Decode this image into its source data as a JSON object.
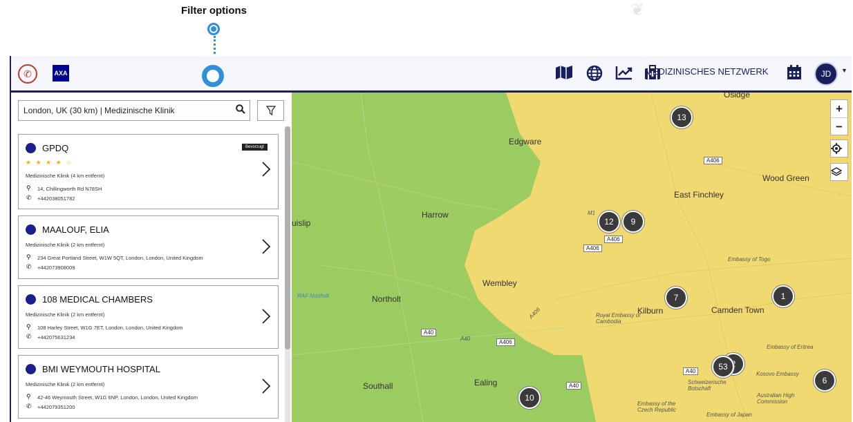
{
  "annotation": {
    "label": "Filter options"
  },
  "header": {
    "logo_text": "AXA",
    "network_label": "MEDIZINISCHES NETZWERK",
    "avatar_initials": "JD",
    "icons": [
      "phone-icon",
      "map-icon",
      "globe-icon",
      "chart-icon",
      "medical-kit-icon",
      "calendar-icon"
    ]
  },
  "search": {
    "value": "London, UK (30 km) | Medizinische Klinik"
  },
  "cards": [
    {
      "name": "GPDQ",
      "badge": "Bevorzugt",
      "stars": "★ ★ ★ ★ ☆",
      "type": "Medizinische Klinik (4 km entfernt)",
      "address": "14, Chillingworth Rd N78SH",
      "phone": "+442038051782"
    },
    {
      "name": "MAALOUF, ELIA",
      "type": "Medizinische Klinik (2 km entfernt)",
      "address": "234 Great Portland Street, W1W 5QT, London, London, United Kingdom",
      "phone": "+442073908009"
    },
    {
      "name": "108 MEDICAL CHAMBERS",
      "type": "Medizinische Klinik (2 km entfernt)",
      "address": "108 Harley Street, W1G 7ET, London, London, United Kingdom",
      "phone": "+442075631234"
    },
    {
      "name": "BMI WEYMOUTH HOSPITAL",
      "type": "Medizinische Klinik (2 km entfernt)",
      "address": "42-46 Weymouth Street, W1G 6NP, London, London, United Kingdom",
      "phone": "+442079351200"
    }
  ],
  "map": {
    "colors": {
      "green": "#9ccb62",
      "yellow": "#f0d970",
      "road": "#e8c24a"
    },
    "places": {
      "edgware": "Edgware",
      "harrow": "Harrow",
      "ruislip": "uislip",
      "wembley": "Wembley",
      "northolt": "Northolt",
      "raf_northolt": "RAF Northolt",
      "southall": "Southall",
      "ealing": "Ealing",
      "kilburn": "Kilburn",
      "camden_town": "Camden Town",
      "east_finchley": "East Finchley",
      "wood_green": "Wood Green",
      "osidge": "Osidge",
      "embassy_togo": "Embassy of Togo",
      "royal_embassy_cambodia": "Royal Embassy of Cambodia",
      "embassy_eritrea": "Embassy of Eritrea",
      "kosovo_embassy": "Kosovo Embassy",
      "australian_high_commission": "Australian High Commission",
      "schweizerische_botschaft": "Schweizerische Botschaft",
      "embassy_czech": "Embassy of the Czech Republic",
      "embassy_japan": "Embassy of Japan",
      "m1": "M1"
    },
    "roads": {
      "a406_1": "A406",
      "a406_2": "A406",
      "a406_3": "A406",
      "a406_4": "A406",
      "a40_1": "A40",
      "a40_2": "A40",
      "a40_3": "A40",
      "a40_4": "A40",
      "a406_diag": "A406",
      "a40_diag": "A40"
    },
    "clusters": {
      "c13": "13",
      "c12": "12",
      "c9": "9",
      "c7": "7",
      "c1": "1",
      "c53": "53",
      "c2": "2",
      "c6": "6",
      "c10": "10"
    },
    "zoom_in": "+",
    "zoom_out": "−"
  }
}
